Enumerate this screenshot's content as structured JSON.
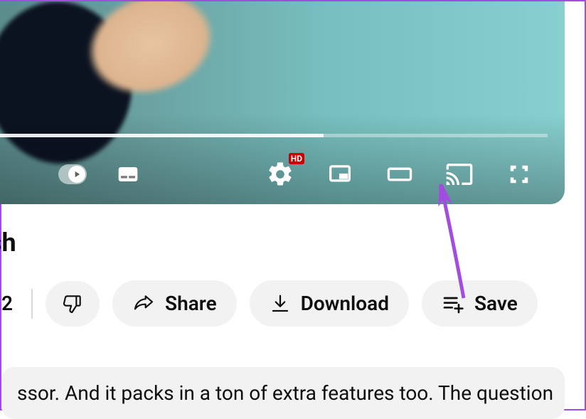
{
  "player": {
    "hd_badge": "HD",
    "progress_percent": 60
  },
  "title_fragment": "sh",
  "actions": {
    "like_count_fragment": "2",
    "share_label": "Share",
    "download_label": "Download",
    "save_label": "Save"
  },
  "description_fragment": "ssor. And it packs in a ton of extra features too. The question"
}
